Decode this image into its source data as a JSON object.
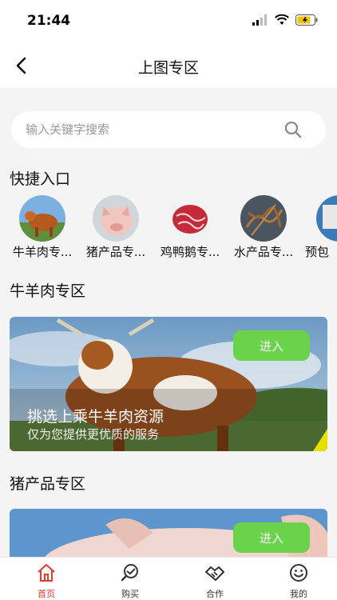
{
  "status_bar": {
    "time": "21:44"
  },
  "nav": {
    "title": "上图专区"
  },
  "search": {
    "placeholder": "输入关键字搜索"
  },
  "quick_entry": {
    "title": "快捷入口",
    "items": [
      {
        "label": "牛羊肉专...",
        "icon": "cattle-thumb"
      },
      {
        "label": "猪产品专...",
        "icon": "pig-thumb"
      },
      {
        "label": "鸡鸭鹅专...",
        "icon": "meat-thumb"
      },
      {
        "label": "水产品专...",
        "icon": "seafood-thumb"
      },
      {
        "label": "预包",
        "icon": "packaged-thumb"
      }
    ]
  },
  "sections": [
    {
      "title": "牛羊肉专区",
      "banner_title": "挑选上乘牛羊肉资源",
      "banner_subtitle": "仅为您提供更优质的服务",
      "enter_label": "进入"
    },
    {
      "title": "猪产品专区",
      "enter_label": "进入"
    }
  ],
  "tabbar": {
    "items": [
      {
        "label": "首页",
        "icon": "home-icon",
        "active": true
      },
      {
        "label": "购买",
        "icon": "buy-icon",
        "active": false
      },
      {
        "label": "合作",
        "icon": "handshake-icon",
        "active": false
      },
      {
        "label": "我的",
        "icon": "smiley-icon",
        "active": false
      }
    ]
  },
  "colors": {
    "accent_green": "#6ad24b",
    "active_tab": "#e23a2e",
    "background": "#f4f4f4"
  }
}
